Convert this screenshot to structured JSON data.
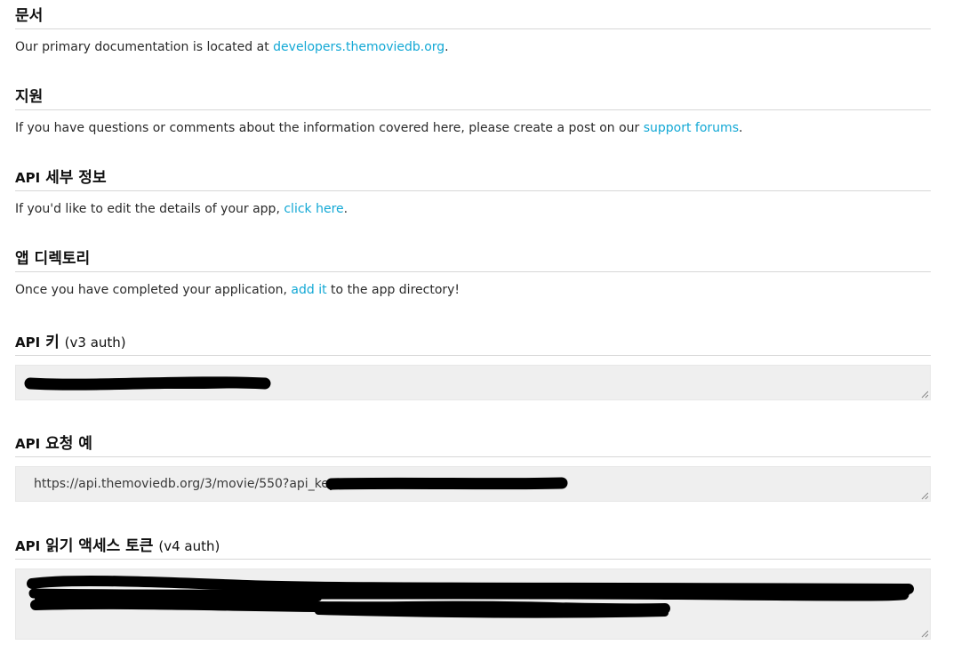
{
  "sections": {
    "docs": {
      "heading": "문서",
      "text_before": "Our primary documentation is located at ",
      "link": "developers.themoviedb.org",
      "text_after": "."
    },
    "support": {
      "heading": "지원",
      "text_before": "If you have questions or comments about the information covered here, please create a post on our ",
      "link": "support forums",
      "text_after": "."
    },
    "details": {
      "heading_prefix": "API",
      "heading": "세부 정보",
      "text_before": "If you'd like to edit the details of your app, ",
      "link": "click here",
      "text_after": "."
    },
    "directory": {
      "heading": "앱 디렉토리",
      "text_before": "Once you have completed your application, ",
      "link": "add it",
      "text_after": " to the app directory!"
    },
    "api_key": {
      "heading_prefix": "API",
      "heading": "키",
      "heading_suffix": "(v3 auth)"
    },
    "example": {
      "heading_prefix": "API",
      "heading": "요청 예",
      "url_prefix": "https://api.themoviedb.org/3/movie/550?api_key="
    },
    "token": {
      "heading_prefix": "API",
      "heading": "읽기 액세스 토큰",
      "heading_suffix": "(v4 auth)"
    }
  },
  "colors": {
    "link": "#12a8d5",
    "field_bg": "#efefef",
    "rule": "#d7d7d7",
    "redaction": "#000000"
  },
  "icons": {
    "resize": "resize-grip-icon"
  }
}
